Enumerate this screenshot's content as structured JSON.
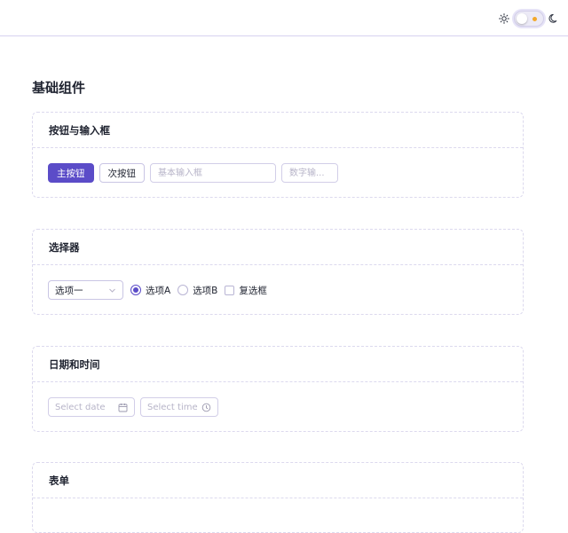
{
  "header": {
    "theme_toggle": {
      "light_icon": "sun-icon",
      "dark_icon": "moon-icon",
      "state": "light",
      "accent": "#f3a82b"
    }
  },
  "page": {
    "title": "基础组件"
  },
  "colors": {
    "primary": "#5b4cc8",
    "border": "#d2cee8",
    "placeholder": "#b7b4c8"
  },
  "sections": {
    "buttons": {
      "title": "按钮与输入框",
      "primary_button": "主按钮",
      "secondary_button": "次按钮",
      "basic_input_placeholder": "基本输入框",
      "number_input_placeholder": "数字输..."
    },
    "selectors": {
      "title": "选择器",
      "select_value": "选项一",
      "radio_a": "选项A",
      "radio_b": "选项B",
      "checkbox": "复选框",
      "radio_selected": "选项A"
    },
    "datetime": {
      "title": "日期和时间",
      "date_placeholder": "Select date",
      "time_placeholder": "Select time"
    },
    "form": {
      "title": "表单"
    }
  }
}
